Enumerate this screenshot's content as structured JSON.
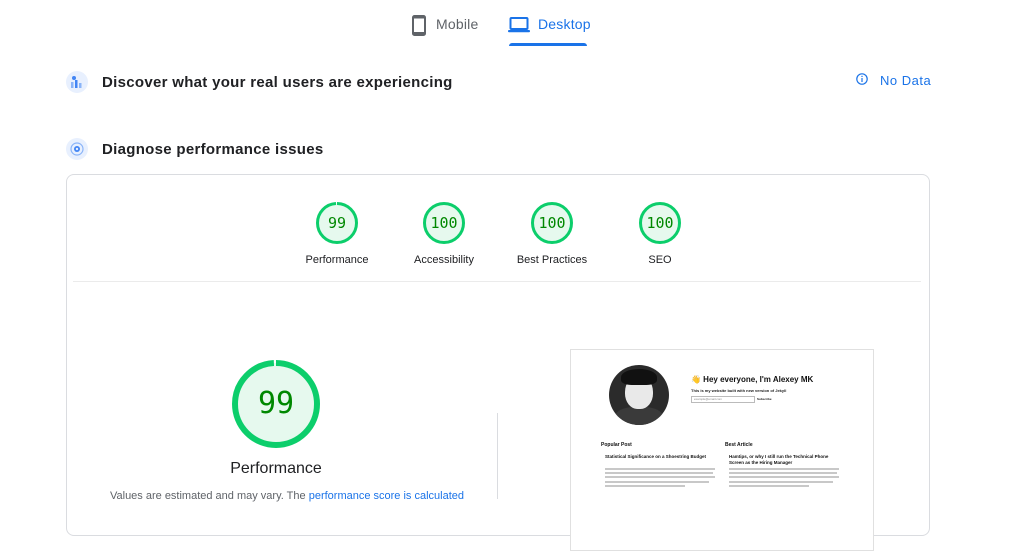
{
  "tabs": [
    {
      "label": "Mobile",
      "active": false,
      "icon": "smartphone-icon"
    },
    {
      "label": "Desktop",
      "active": true,
      "icon": "laptop-icon"
    }
  ],
  "field_data": {
    "title": "Discover what your real users are experiencing",
    "status": "No Data",
    "icon": "users-chart-icon",
    "status_icon": "info-icon"
  },
  "lab_data": {
    "title": "Diagnose performance issues",
    "icon": "lighthouse-icon"
  },
  "colors": {
    "accent": "#1a73e8",
    "pass": "#0cce6b",
    "pass_bg": "#e6f9ee",
    "pass_text": "#008800"
  },
  "scores": [
    {
      "value": "99",
      "label": "Performance",
      "fraction": 0.99
    },
    {
      "value": "100",
      "label": "Accessibility",
      "fraction": 1.0
    },
    {
      "value": "100",
      "label": "Best Practices",
      "fraction": 1.0
    },
    {
      "value": "100",
      "label": "SEO",
      "fraction": 1.0
    }
  ],
  "performance": {
    "score": "99",
    "fraction": 0.99,
    "label": "Performance",
    "note_prefix": "Values are estimated and may vary. The",
    "note_link": "performance score is calculated"
  },
  "preview": {
    "greeting": "👋 Hey everyone, I'm Alexey MK",
    "subtitle": "This is my website built with new version of Jekyll",
    "email_placeholder": "example@email.com",
    "subscribe": "Subscribe",
    "popular_heading": "Popular Post",
    "popular_title": "Statistical Significance on a Shoestring Budget",
    "best_heading": "Best Article",
    "best_title": "Hamtips, or why I still run the Technical Phone Screen as the Hiring Manager"
  }
}
